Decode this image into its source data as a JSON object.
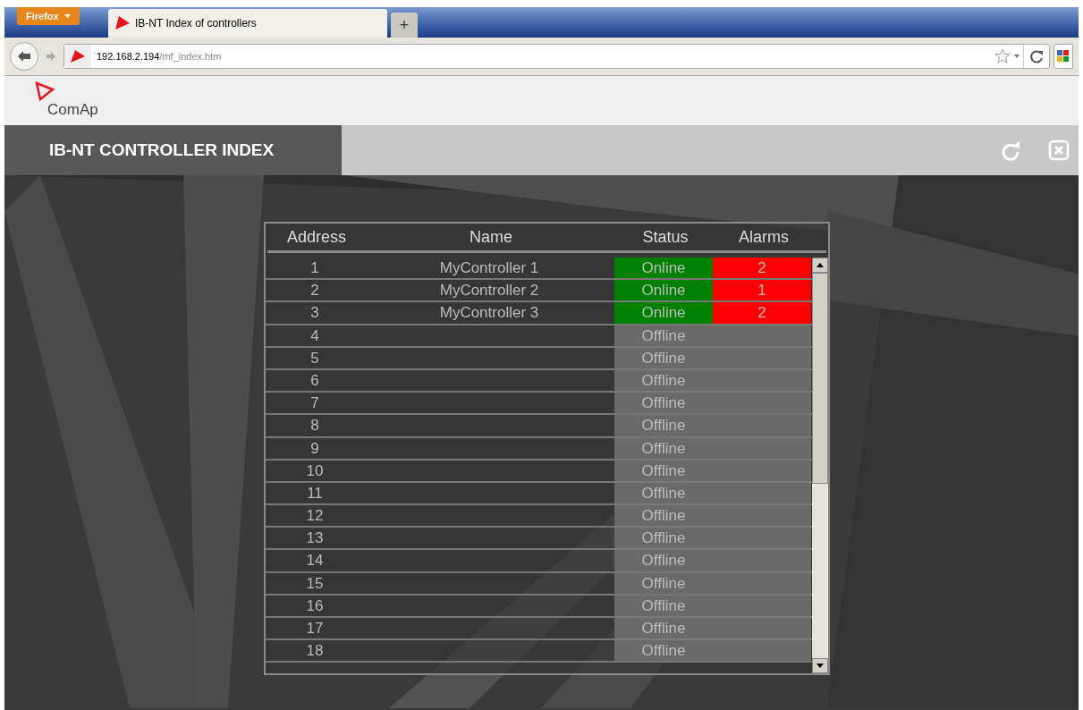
{
  "browser": {
    "menu_button": "Firefox",
    "tab_title": "IB-NT Index of controllers",
    "new_tab": "+",
    "address_host": "192.168.2.194",
    "address_path": "/mf_index.htm"
  },
  "header": {
    "logo_text": "ComAp",
    "title": "IB-NT CONTROLLER INDEX"
  },
  "table": {
    "columns": [
      "Address",
      "Name",
      "Status",
      "Alarms"
    ],
    "rows": [
      {
        "address": "1",
        "name": "MyController 1",
        "status": "Online",
        "kind": "online",
        "alarms": "2"
      },
      {
        "address": "2",
        "name": "MyController 2",
        "status": "Online",
        "kind": "online",
        "alarms": "1"
      },
      {
        "address": "3",
        "name": "MyController 3",
        "status": "Online",
        "kind": "online",
        "alarms": "2"
      },
      {
        "address": "4",
        "status": "Offline",
        "kind": "offline"
      },
      {
        "address": "5",
        "status": "Offline",
        "kind": "offline"
      },
      {
        "address": "6",
        "status": "Offline",
        "kind": "offline"
      },
      {
        "address": "7",
        "status": "Offline",
        "kind": "offline"
      },
      {
        "address": "8",
        "status": "Offline",
        "kind": "offline"
      },
      {
        "address": "9",
        "status": "Offline",
        "kind": "offline"
      },
      {
        "address": "10",
        "status": "Offline",
        "kind": "offline"
      },
      {
        "address": "11",
        "status": "Offline",
        "kind": "offline"
      },
      {
        "address": "12",
        "status": "Offline",
        "kind": "offline"
      },
      {
        "address": "13",
        "status": "Offline",
        "kind": "offline"
      },
      {
        "address": "14",
        "status": "Offline",
        "kind": "offline"
      },
      {
        "address": "15",
        "status": "Offline",
        "kind": "offline"
      },
      {
        "address": "16",
        "status": "Offline",
        "kind": "offline"
      },
      {
        "address": "17",
        "status": "Offline",
        "kind": "offline"
      },
      {
        "address": "18",
        "status": "Offline",
        "kind": "offline"
      }
    ]
  }
}
